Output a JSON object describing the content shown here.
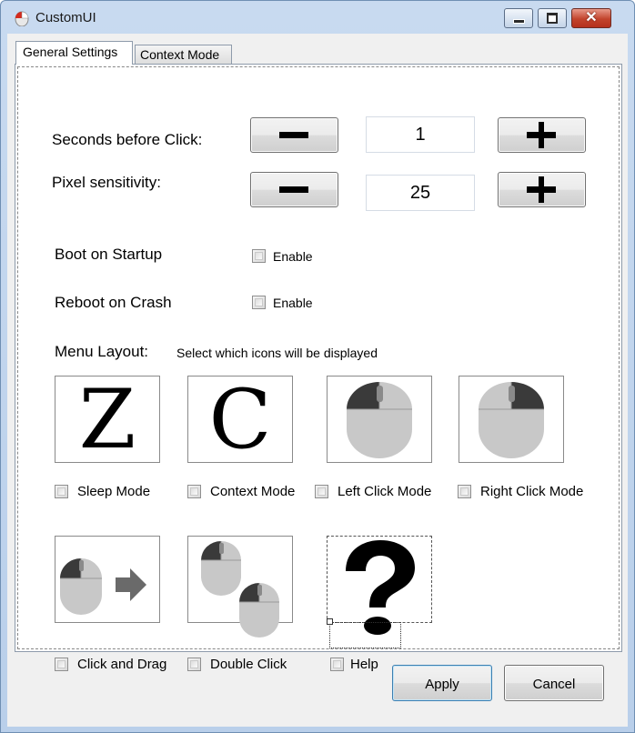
{
  "window": {
    "title": "CustomUI",
    "close_glyph": "✕"
  },
  "tabs": [
    {
      "label": "General Settings",
      "active": true
    },
    {
      "label": "Context Mode",
      "active": false
    }
  ],
  "settings": {
    "seconds_label": "Seconds before Click:",
    "seconds_value": "1",
    "pixel_label": "Pixel sensitivity:",
    "pixel_value": "25",
    "boot_label": "Boot on Startup",
    "boot_checkbox": "Enable",
    "reboot_label": "Reboot on Crash",
    "reboot_checkbox": "Enable"
  },
  "menu_layout": {
    "label": "Menu Layout:",
    "hint": "Select which icons will be displayed",
    "icons": [
      {
        "label": "Sleep Mode",
        "glyph": "Z",
        "icon": "sleep-z-icon"
      },
      {
        "label": "Context Mode",
        "glyph": "C",
        "icon": "context-c-icon"
      },
      {
        "label": "Left Click Mode",
        "icon": "mouse-left-click-icon"
      },
      {
        "label": "Right Click Mode",
        "icon": "mouse-right-click-icon"
      },
      {
        "label": "Click and Drag",
        "icon": "mouse-drag-icon"
      },
      {
        "label": "Double Click",
        "icon": "mouse-double-click-icon"
      },
      {
        "label": "Help",
        "icon": "question-mark-icon"
      }
    ]
  },
  "buttons": {
    "apply": "Apply",
    "cancel": "Cancel"
  },
  "colors": {
    "mouse_body": "#cccccc",
    "mouse_button_dark": "#333333",
    "title_gradient": "#c8daf0",
    "close_button": "#c2432c"
  }
}
